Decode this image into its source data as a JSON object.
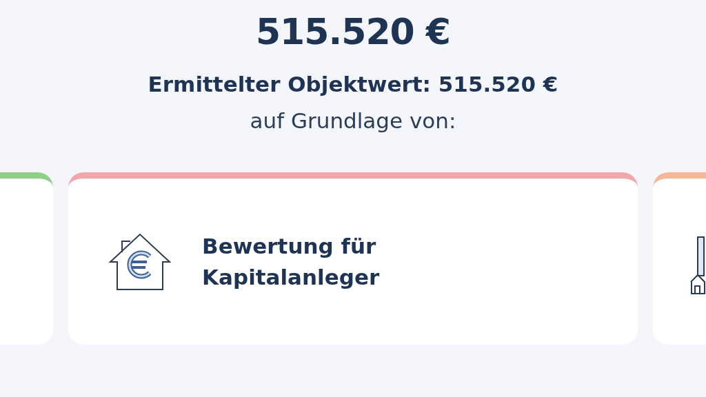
{
  "result": {
    "value": "515.520 €",
    "summary": "Ermittelter Objektwert: 515.520 €",
    "basis_label": "auf Grundlage von:"
  },
  "cards": [
    {
      "kind": "empty",
      "color": "#8fcf8a"
    },
    {
      "kind": "investor",
      "color": "#f2a7ad",
      "title": "Bewertung für Kapitalanleger"
    },
    {
      "kind": "tower",
      "color": "#f5b896"
    }
  ]
}
